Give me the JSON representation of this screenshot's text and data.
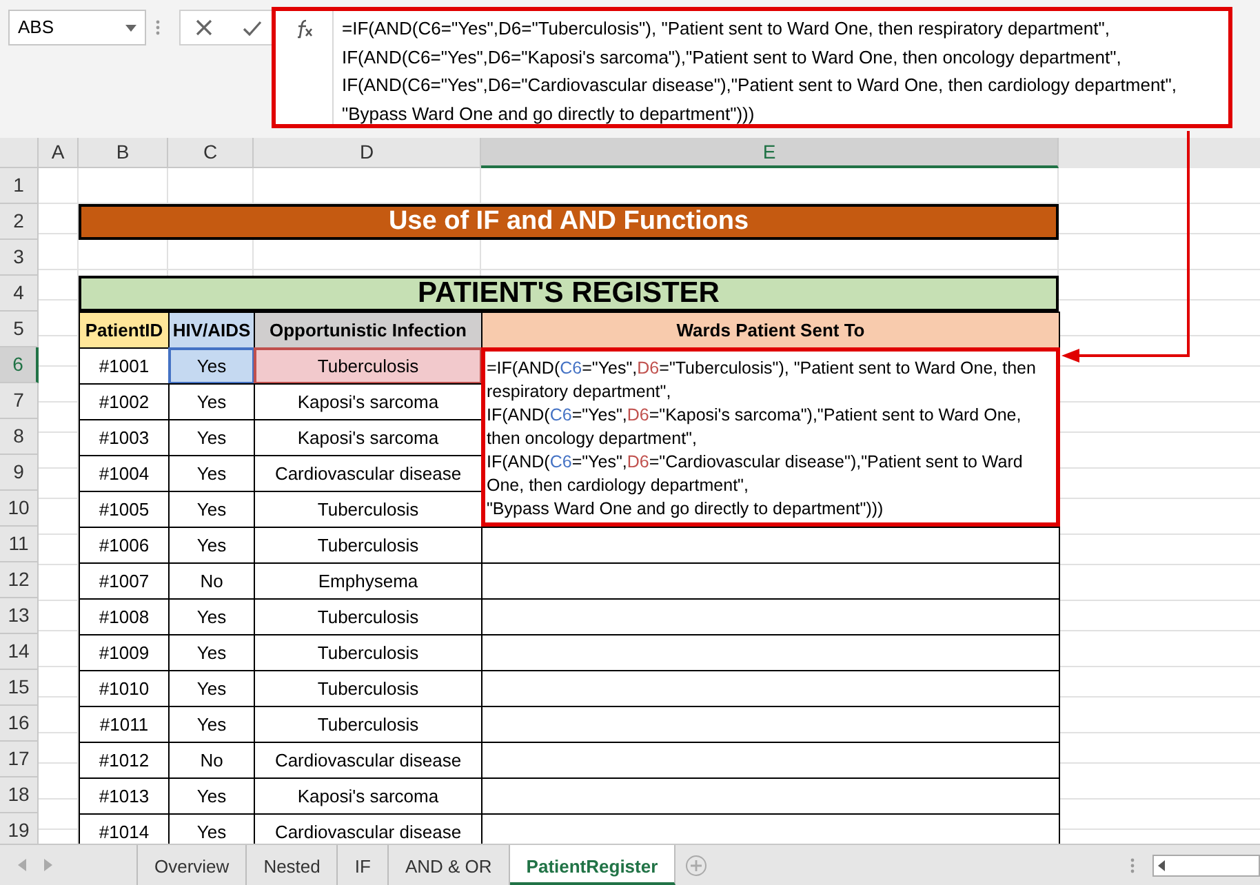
{
  "name_box": "ABS",
  "formula_bar": {
    "segments": [
      {
        "text": "=IF(AND(C6=\"Yes\",D6=\"Tuberculosis\"), \"Patient sent to Ward One, then respiratory department\",\nIF(AND(C6=\"Yes\",D6=\"Kaposi's sarcoma\"),\"Patient sent to Ward One, then oncology department\",\nIF(AND(C6=\"Yes\",D6=\"Cardiovascular disease\"),\"Patient sent to Ward One, then cardiology department\",\n\"Bypass Ward One and go directly to department\")))",
        "color": "#000000"
      }
    ]
  },
  "columns": [
    {
      "label": "A",
      "selected": false
    },
    {
      "label": "B",
      "selected": false
    },
    {
      "label": "C",
      "selected": false
    },
    {
      "label": "D",
      "selected": false
    },
    {
      "label": "E",
      "selected": true
    }
  ],
  "row_numbers": [
    {
      "label": "1",
      "selected": false
    },
    {
      "label": "2",
      "selected": false
    },
    {
      "label": "3",
      "selected": false
    },
    {
      "label": "4",
      "selected": false
    },
    {
      "label": "5",
      "selected": false
    },
    {
      "label": "6",
      "selected": true
    },
    {
      "label": "7",
      "selected": false
    },
    {
      "label": "8",
      "selected": false
    },
    {
      "label": "9",
      "selected": false
    },
    {
      "label": "10",
      "selected": false
    },
    {
      "label": "11",
      "selected": false
    },
    {
      "label": "12",
      "selected": false
    },
    {
      "label": "13",
      "selected": false
    },
    {
      "label": "14",
      "selected": false
    },
    {
      "label": "15",
      "selected": false
    },
    {
      "label": "16",
      "selected": false
    },
    {
      "label": "17",
      "selected": false
    },
    {
      "label": "18",
      "selected": false
    },
    {
      "label": "19",
      "selected": false
    }
  ],
  "title": "Use of IF and AND Functions",
  "register_title": "PATIENT'S REGISTER",
  "headers": [
    "PatientID",
    "HIV/AIDS",
    "Opportunistic Infection",
    "Wards Patient Sent To"
  ],
  "rows": [
    {
      "id": "#1001",
      "hiv": "Yes",
      "infection": "Tuberculosis",
      "highlighted": true
    },
    {
      "id": "#1002",
      "hiv": "Yes",
      "infection": "Kaposi's sarcoma",
      "highlighted": false
    },
    {
      "id": "#1003",
      "hiv": "Yes",
      "infection": "Kaposi's sarcoma",
      "highlighted": false
    },
    {
      "id": "#1004",
      "hiv": "Yes",
      "infection": "Cardiovascular disease",
      "highlighted": false
    },
    {
      "id": "#1005",
      "hiv": "Yes",
      "infection": "Tuberculosis",
      "highlighted": false
    },
    {
      "id": "#1006",
      "hiv": "Yes",
      "infection": "Tuberculosis",
      "highlighted": false
    },
    {
      "id": "#1007",
      "hiv": "No",
      "infection": "Emphysema",
      "highlighted": false
    },
    {
      "id": "#1008",
      "hiv": "Yes",
      "infection": "Tuberculosis",
      "highlighted": false
    },
    {
      "id": "#1009",
      "hiv": "Yes",
      "infection": "Tuberculosis",
      "highlighted": false
    },
    {
      "id": "#1010",
      "hiv": "Yes",
      "infection": "Tuberculosis",
      "highlighted": false
    },
    {
      "id": "#1011",
      "hiv": "Yes",
      "infection": "Tuberculosis",
      "highlighted": false
    },
    {
      "id": "#1012",
      "hiv": "No",
      "infection": "Cardiovascular disease",
      "highlighted": false
    },
    {
      "id": "#1013",
      "hiv": "Yes",
      "infection": "Kaposi's sarcoma",
      "highlighted": false
    },
    {
      "id": "#1014",
      "hiv": "Yes",
      "infection": "Cardiovascular disease",
      "highlighted": false
    }
  ],
  "editing_cell": {
    "segments": [
      {
        "text": "=IF(AND(",
        "color": "#000000"
      },
      {
        "text": "C6",
        "color": "#4472c4"
      },
      {
        "text": "=\"Yes\",",
        "color": "#000000"
      },
      {
        "text": "D6",
        "color": "#c0504d"
      },
      {
        "text": "=\"Tuberculosis\"), \"Patient sent to Ward One, then respiratory department\",\nIF(AND(",
        "color": "#000000"
      },
      {
        "text": "C6",
        "color": "#4472c4"
      },
      {
        "text": "=\"Yes\",",
        "color": "#000000"
      },
      {
        "text": "D6",
        "color": "#c0504d"
      },
      {
        "text": "=\"Kaposi's sarcoma\"),\"Patient sent to Ward One, then oncology department\",\nIF(AND(",
        "color": "#000000"
      },
      {
        "text": "C6",
        "color": "#4472c4"
      },
      {
        "text": "=\"Yes\",",
        "color": "#000000"
      },
      {
        "text": "D6",
        "color": "#c0504d"
      },
      {
        "text": "=\"Cardiovascular disease\"),\"Patient sent to Ward One, then cardiology department\",\n\"Bypass Ward One and go directly to department\")))",
        "color": "#000000"
      }
    ]
  },
  "sheet_tabs": [
    {
      "label": "Overview",
      "selected": false
    },
    {
      "label": "Nested",
      "selected": false
    },
    {
      "label": "IF",
      "selected": false
    },
    {
      "label": "AND & OR",
      "selected": false
    },
    {
      "label": "PatientRegister",
      "selected": true
    }
  ]
}
